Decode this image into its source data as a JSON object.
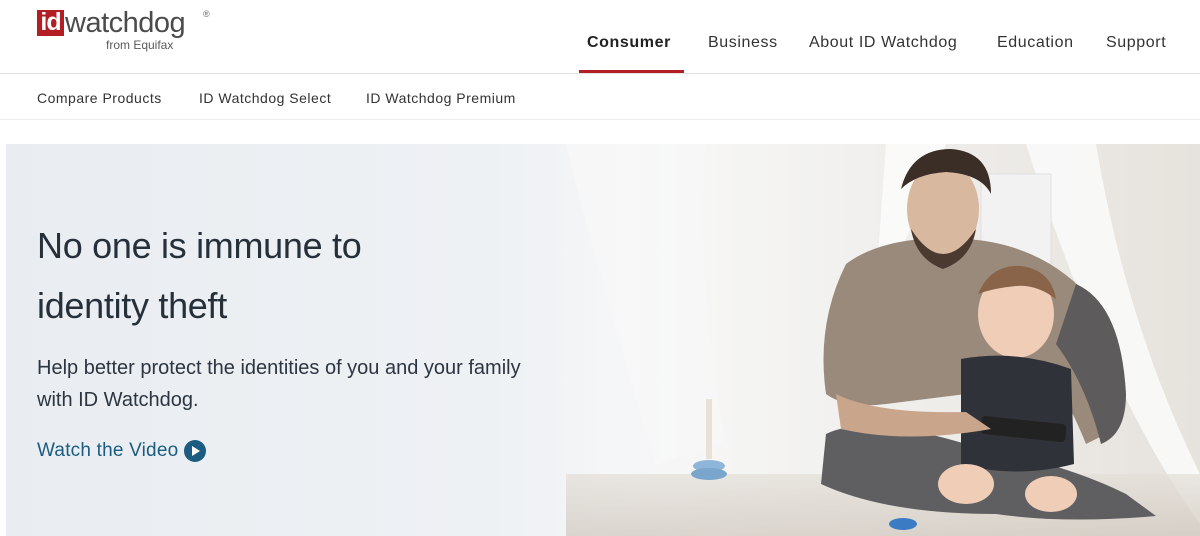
{
  "brand": {
    "logo_id": "id",
    "logo_word": "watchdog",
    "logo_reg": "®",
    "logo_sub": "from Equifax",
    "accent_color": "#b21e23",
    "link_color": "#1b5c80"
  },
  "main_nav": {
    "items": [
      {
        "label": "Consumer",
        "active": true
      },
      {
        "label": "Business"
      },
      {
        "label": "About ID Watchdog"
      },
      {
        "label": "Education"
      },
      {
        "label": "Support"
      }
    ]
  },
  "sub_nav": {
    "items": [
      {
        "label": "Compare Products"
      },
      {
        "label": "ID Watchdog Select"
      },
      {
        "label": "ID Watchdog Premium"
      }
    ]
  },
  "hero": {
    "title_line1": "No one is immune to",
    "title_line2": "identity theft",
    "body_line1": "Help better protect the identities of you and your family",
    "body_line2": "with ID Watchdog.",
    "cta_label": "Watch the Video",
    "cta_icon": "play-circle-icon"
  }
}
